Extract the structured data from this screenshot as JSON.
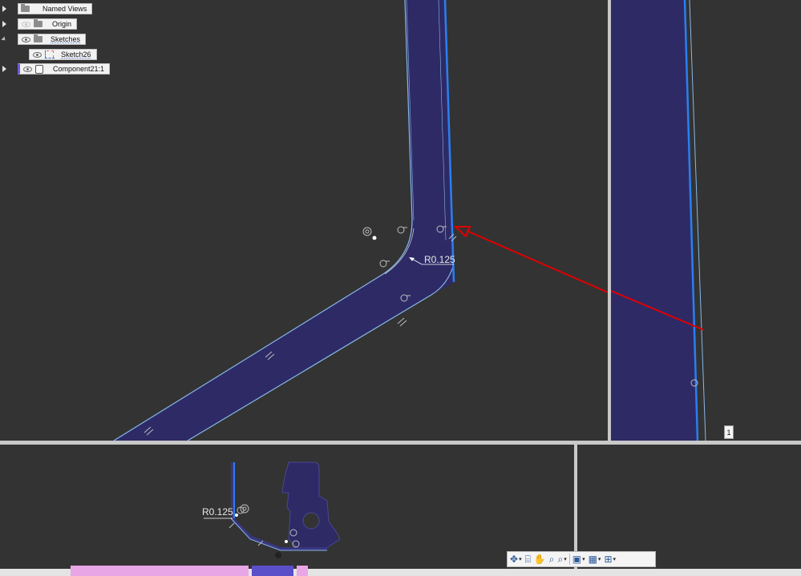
{
  "browser": {
    "items": [
      {
        "label": "Named Views",
        "expand": "collapsed",
        "eye": "none",
        "icon": "folder-icon"
      },
      {
        "label": "Origin",
        "expand": "collapsed",
        "eye": "faded",
        "icon": "folder-icon"
      },
      {
        "label": "Sketches",
        "expand": "expanded",
        "eye": "visible",
        "icon": "folder-icon"
      },
      {
        "label": "Sketch26",
        "expand": "none",
        "eye": "visible",
        "icon": "sketch-icon"
      },
      {
        "label": "Component21:1",
        "expand": "collapsed",
        "eye": "visible",
        "icon": "component-icon"
      }
    ]
  },
  "dimensions": {
    "main_radius": "R0.125",
    "bottom_radius": "R0.125"
  },
  "viewport_right": {
    "count_badge": "1"
  },
  "annotation": {
    "arrow_color": "#e00000"
  },
  "colors": {
    "background": "#333333",
    "body_fill": "#2e2a66",
    "edge_light": "#86b8e8",
    "edge_selected": "#2a7ff0"
  },
  "nav_toolbar": {
    "tools": [
      "orbit-icon",
      "look-at-icon",
      "pan-icon",
      "zoom-icon",
      "fit-icon",
      "display-settings-icon",
      "grid-icon",
      "viewports-icon"
    ]
  }
}
